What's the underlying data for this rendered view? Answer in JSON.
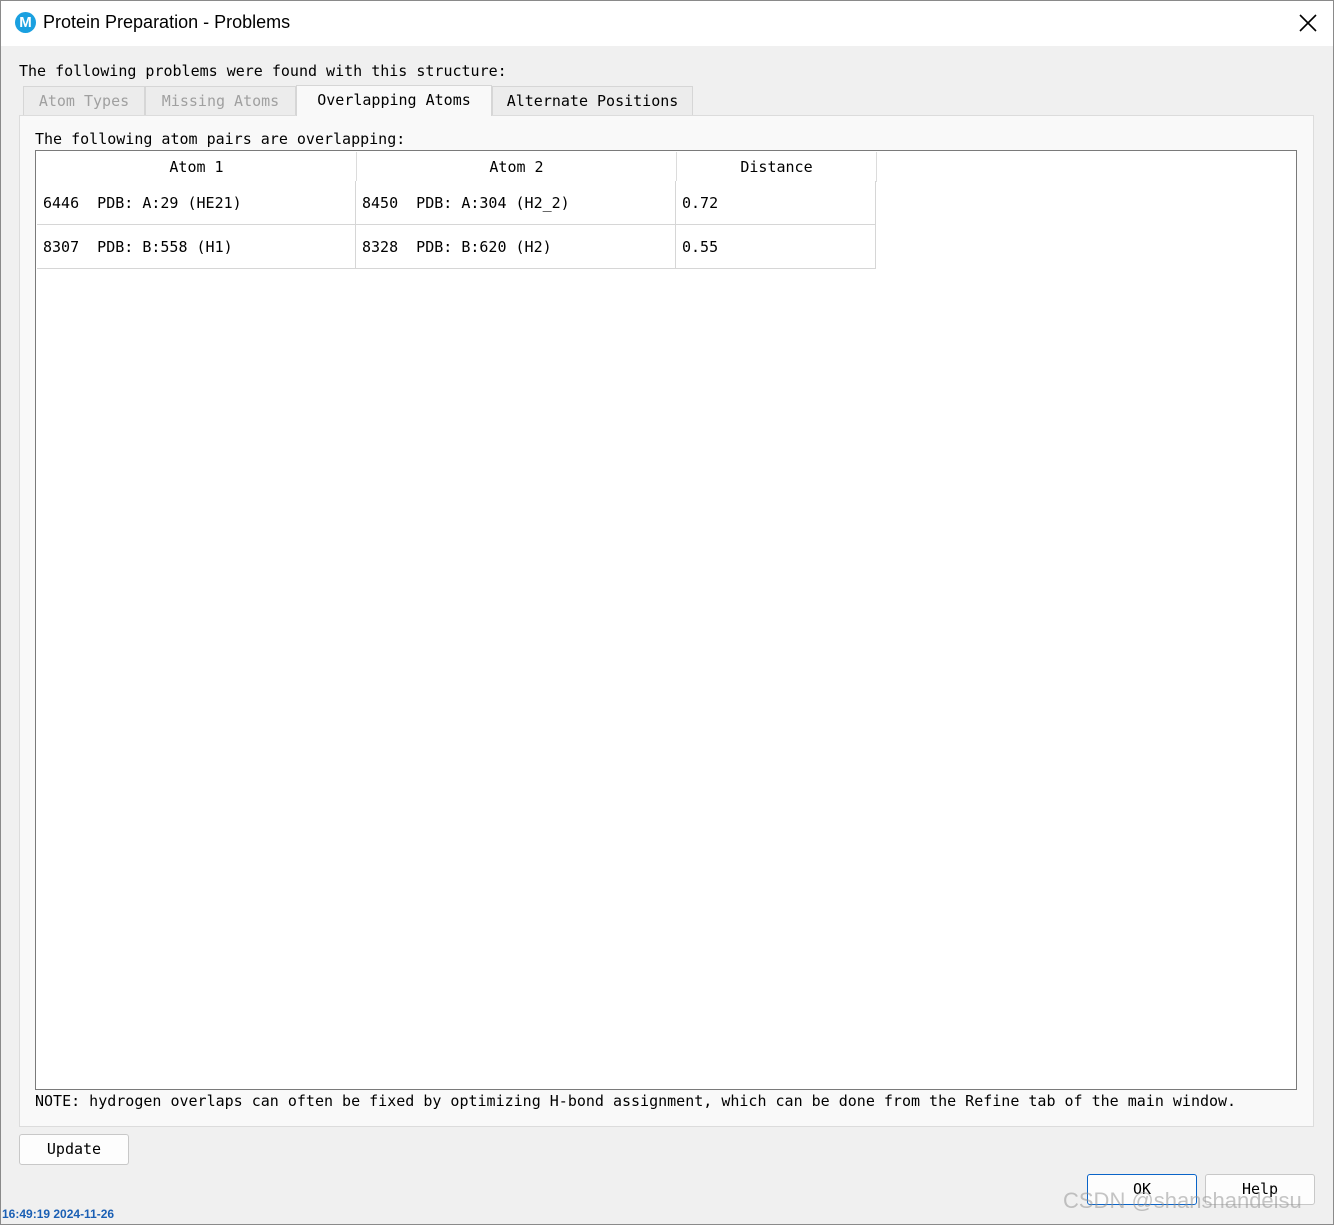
{
  "window": {
    "title": "Protein Preparation - Problems",
    "app_icon_letter": "M",
    "close_icon": "close-icon"
  },
  "problems_heading": "The following problems were found with this structure:",
  "tabs": [
    {
      "label": "Atom Types",
      "state": "disabled"
    },
    {
      "label": "Missing Atoms",
      "state": "disabled"
    },
    {
      "label": "Overlapping Atoms",
      "state": "selected"
    },
    {
      "label": "Alternate Positions",
      "state": "normal"
    }
  ],
  "overlapping": {
    "heading": "The following atom pairs are overlapping:",
    "columns": [
      "Atom 1",
      "Atom 2",
      "Distance"
    ],
    "rows": [
      {
        "atom1": "6446  PDB: A:29 (HE21)",
        "atom2": "8450  PDB: A:304 (H2_2)",
        "distance": "0.72"
      },
      {
        "atom1": "8307  PDB: B:558 (H1)",
        "atom2": "8328  PDB: B:620 (H2)",
        "distance": "0.55"
      }
    ],
    "note": "NOTE: hydrogen overlaps can often be fixed by optimizing H-bond assignment, which can be done from the Refine tab of the main window."
  },
  "buttons": {
    "update": "Update",
    "ok": "OK",
    "help": "Help"
  },
  "overlay": {
    "timestamp": "16:49:19 2024-11-26",
    "watermark": "CSDN @shanshandeisu"
  },
  "colors": {
    "app_icon": "#1aa0e0",
    "default_button_border": "#0a64c8",
    "timestamp": "#1a5fb4"
  }
}
